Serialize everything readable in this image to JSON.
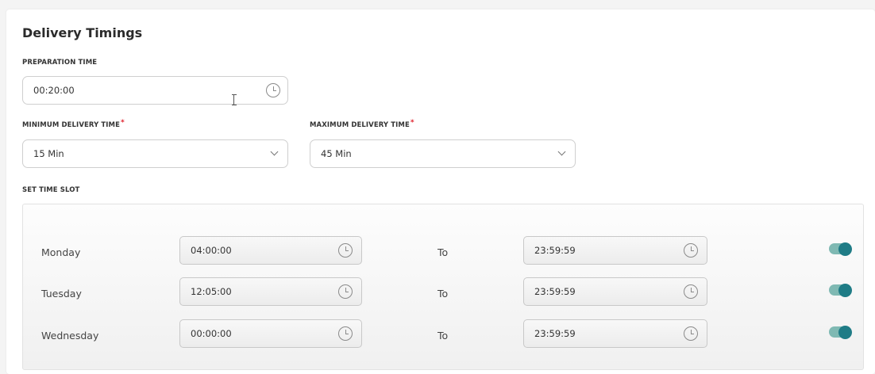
{
  "section": {
    "title": "Delivery Timings"
  },
  "preparation": {
    "label": "PREPARATION TIME",
    "value": "00:20:00"
  },
  "min_delivery": {
    "label": "MINIMUM DELIVERY TIME",
    "required_mark": "*",
    "value": "15 Min"
  },
  "max_delivery": {
    "label": "MAXIMUM DELIVERY TIME",
    "required_mark": "*",
    "value": "45 Min"
  },
  "time_slot": {
    "label": "SET TIME SLOT",
    "to_label": "To",
    "rows": [
      {
        "day": "Monday",
        "from": "04:00:00",
        "to": "23:59:59",
        "enabled": true
      },
      {
        "day": "Tuesday",
        "from": "12:05:00",
        "to": "23:59:59",
        "enabled": true
      },
      {
        "day": "Wednesday",
        "from": "00:00:00",
        "to": "23:59:59",
        "enabled": true
      }
    ]
  },
  "colors": {
    "toggle_track": "#7fb9b3",
    "toggle_knob": "#1f7c86",
    "required": "#e0242f"
  }
}
